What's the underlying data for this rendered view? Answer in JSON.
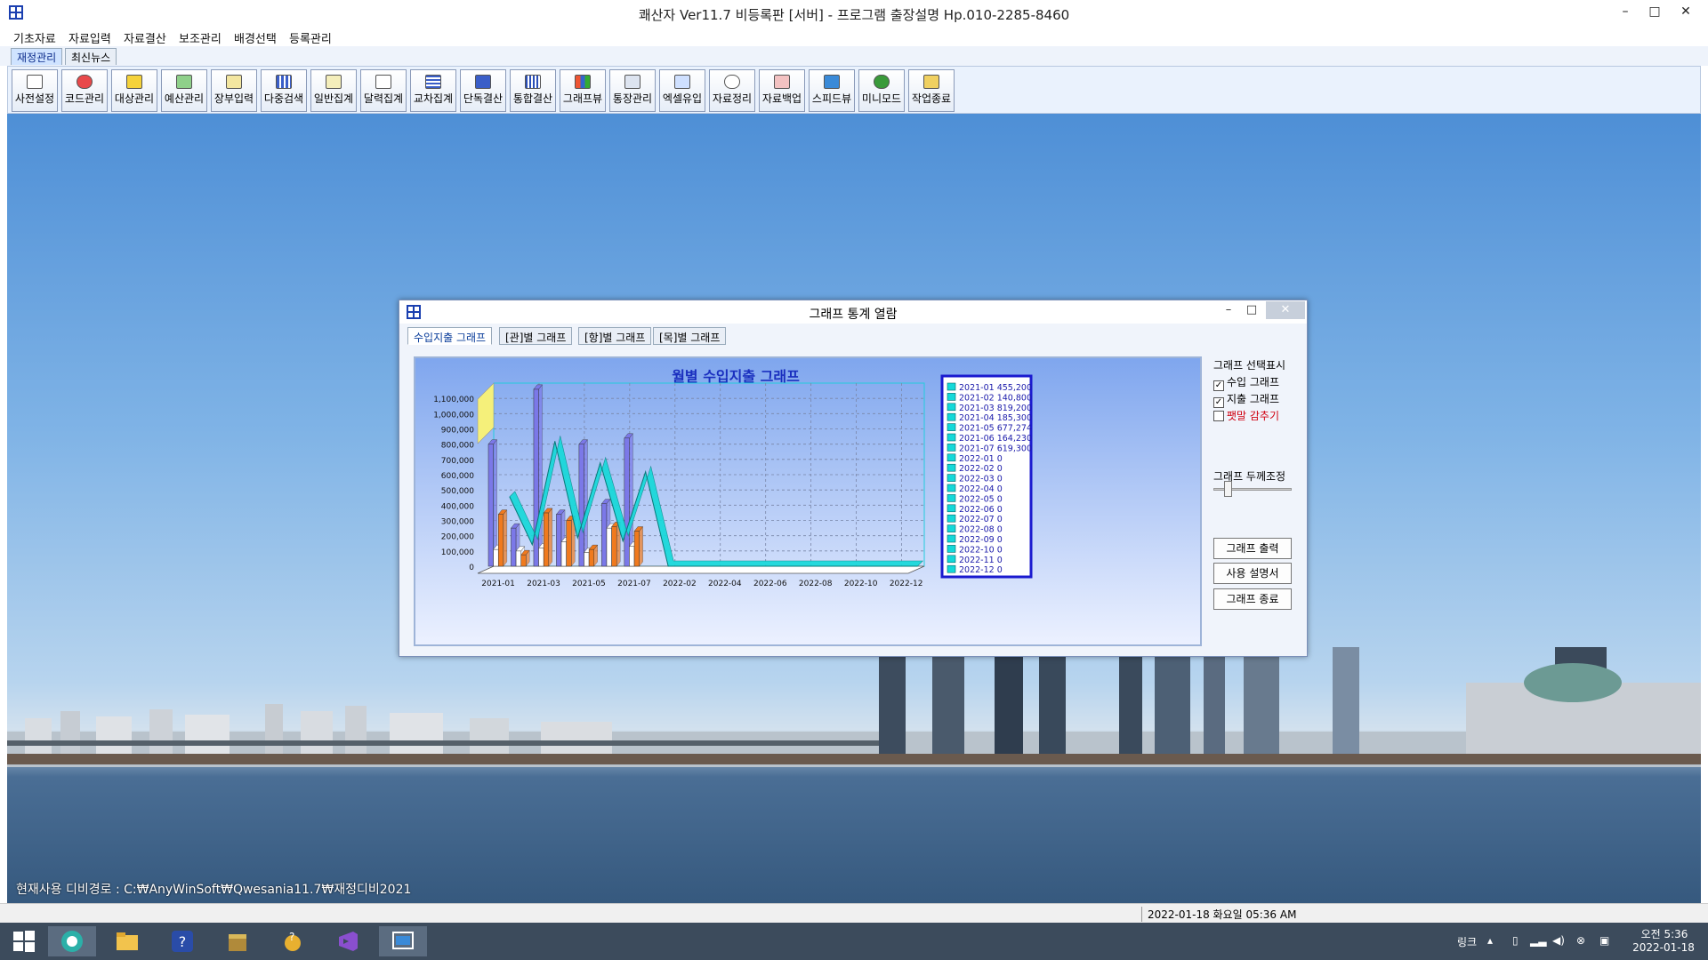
{
  "window": {
    "title": "쾌산자 Ver11.7 비등록판 [서버] - 프로그램 출장설명 Hp.010-2285-8460",
    "min": "–",
    "max": "□",
    "close": "✕"
  },
  "menu": [
    "기초자료",
    "자료입력",
    "자료결산",
    "보조관리",
    "배경선택",
    "등록관리"
  ],
  "top_tabs": [
    "재정관리",
    "최신뉴스"
  ],
  "toolbar": [
    "사전설정",
    "코드관리",
    "대상관리",
    "예산관리",
    "장부입력",
    "다중검색",
    "일반집계",
    "달력집계",
    "교차집계",
    "단독결산",
    "통합결산",
    "그래프뷰",
    "통장관리",
    "엑셀유입",
    "자료정리",
    "자료백업",
    "스피드뷰",
    "미니모드",
    "작업종료"
  ],
  "db_path": "현재사용 디비경로 : C:₩AnyWinSoft₩Qwesania11.7₩재정디비2021",
  "status_date": "2022-01-18 화요일 05:36 AM",
  "tray": {
    "link": "링크",
    "time": "오전 5:36",
    "date": "2022-01-18"
  },
  "dialog": {
    "title": "그래프 통계 열람",
    "tabs": [
      "수입지출 그래프",
      "[관]별 그래프",
      "[항]별 그래프",
      "[목]별 그래프"
    ],
    "options": {
      "header": "그래프 선택표시",
      "income_label": "수입 그래프",
      "expense_label": "지출 그래프",
      "hide_label": "팻말 감추기",
      "income_checked": true,
      "expense_checked": true,
      "hide_checked": false,
      "thickness_label": "그래프 두께조정",
      "thickness_value": 0.15,
      "check_mark": "✓",
      "btn_print": "그래프 출력",
      "btn_manual": "사용 설명서",
      "btn_close": "그래프 종료"
    }
  },
  "chart_data": {
    "type": "bar",
    "title": "월별 수입지출 그래프",
    "categories": [
      "2021-01",
      "2021-02",
      "2021-03",
      "2021-04",
      "2021-05",
      "2021-06",
      "2021-07",
      "2022-01",
      "2022-02",
      "2022-03",
      "2022-04",
      "2022-05",
      "2022-06",
      "2022-07",
      "2022-08",
      "2022-09",
      "2022-10",
      "2022-11",
      "2022-12"
    ],
    "x_tick_labels": [
      "2021-01",
      "2021-03",
      "2021-05",
      "2021-07",
      "2022-02",
      "2022-04",
      "2022-06",
      "2022-08",
      "2022-10",
      "2022-12"
    ],
    "series": [
      {
        "values": [
          800000,
          250000,
          1160000,
          340000,
          800000,
          410000,
          840000,
          0,
          0,
          0,
          0,
          0,
          0,
          0,
          0,
          0,
          0,
          0,
          0
        ],
        "color": "#7b78e8"
      },
      {
        "values": [
          110000,
          100000,
          120000,
          160000,
          90000,
          250000,
          130000,
          0,
          0,
          0,
          0,
          0,
          0,
          0,
          0,
          0,
          0,
          0,
          0
        ],
        "color": "#ffffff"
      },
      {
        "values": [
          340000,
          75000,
          350000,
          300000,
          110000,
          260000,
          230000,
          0,
          0,
          0,
          0,
          0,
          0,
          0,
          0,
          0,
          0,
          0,
          0
        ],
        "color": "#f07a1e"
      },
      {
        "type": "line",
        "values": [
          455200,
          140800,
          819200,
          185300,
          677274,
          164230,
          619300,
          0,
          0,
          0,
          0,
          0,
          0,
          0,
          0,
          0,
          0,
          0,
          0
        ],
        "color": "#13d9d9"
      }
    ],
    "legend": [
      "2021-01 455,200",
      "2021-02 140,800",
      "2021-03 819,200",
      "2021-04 185,300",
      "2021-05 677,274",
      "2021-06 164,230",
      "2021-07 619,300",
      "2022-01 0",
      "2022-02 0",
      "2022-03 0",
      "2022-04 0",
      "2022-05 0",
      "2022-06 0",
      "2022-07 0",
      "2022-08 0",
      "2022-09 0",
      "2022-10 0",
      "2022-11 0",
      "2022-12 0"
    ],
    "y_ticks": [
      "1,100,000",
      "1,000,000",
      "900,000",
      "800,000",
      "700,000",
      "600,000",
      "500,000",
      "400,000",
      "300,000",
      "200,000",
      "100,000",
      "0"
    ],
    "ylim": [
      0,
      1200000
    ],
    "grid": true,
    "legend_position": "right",
    "colors": {
      "background_top": "#7fa6ee",
      "background_bottom": "#ecf1ff",
      "title": "#1a2fbf",
      "legend_border": "#1a1acf",
      "legend_text": "#1a1aaa"
    }
  }
}
